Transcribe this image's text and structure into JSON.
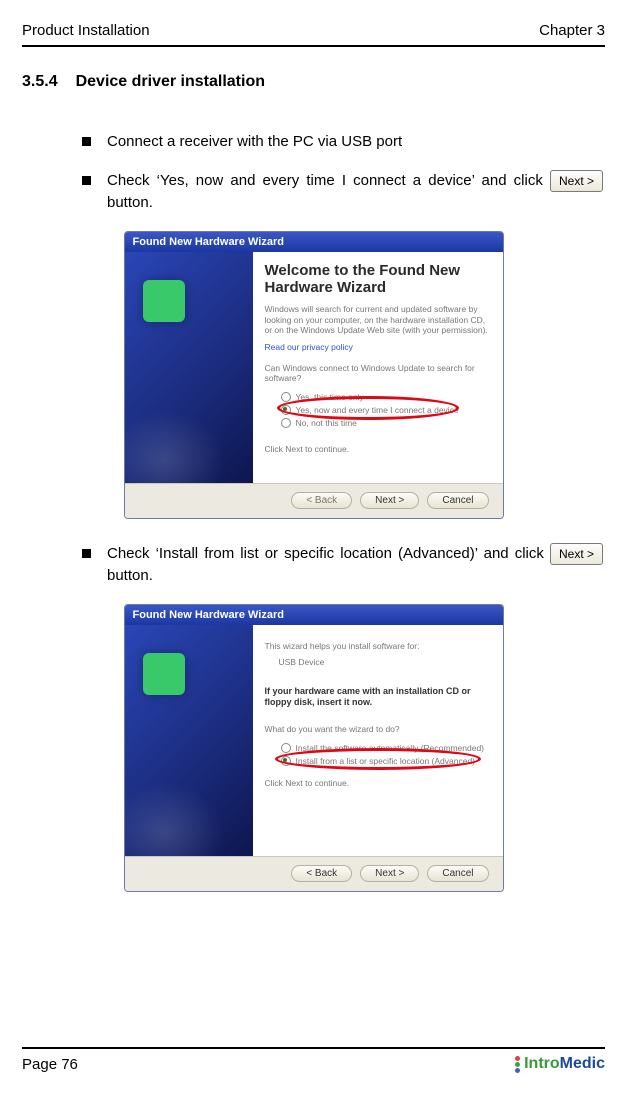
{
  "header": {
    "left": "Product Installation",
    "right": "Chapter 3"
  },
  "section": {
    "num": "3.5.4",
    "title": "Device driver installation"
  },
  "bullets": {
    "b1": "Connect a receiver with the PC via USB port",
    "b2_pre": "Check ‘Yes, now and every time I connect a device’ and click",
    "b2_btn": "Next >",
    "b2_post": " button.",
    "b3_pre": "Check ‘Install from list or specific location (Advanced)’ and click",
    "b3_btn": "Next >",
    "b3_post": " button."
  },
  "wizard1": {
    "titlebar": "Found New Hardware Wizard",
    "heading": "Welcome to the Found New Hardware Wizard",
    "para1": "Windows will search for current and updated software by looking on your computer, on the hardware installation CD, or on the Windows Update Web site (with your permission).",
    "link": "Read our privacy policy",
    "question": "Can Windows connect to Windows Update to search for software?",
    "opt1": "Yes, this time only",
    "opt2": "Yes, now and every time I connect a device",
    "opt3": "No, not this time",
    "proceed": "Click Next to continue.",
    "back": "< Back",
    "next": "Next >",
    "cancel": "Cancel"
  },
  "wizard2": {
    "titlebar": "Found New Hardware Wizard",
    "line1": "This wizard helps you install software for:",
    "device": "USB Device",
    "cd": "If your hardware came with an installation CD or floppy disk, insert it now.",
    "question": "What do you want the wizard to do?",
    "opt1": "Install the software automatically (Recommended)",
    "opt2": "Install from a list or specific location (Advanced)",
    "proceed": "Click Next to continue.",
    "back": "< Back",
    "next": "Next >",
    "cancel": "Cancel"
  },
  "footer": {
    "page": "Page 76",
    "brand1": "Intro",
    "brand2": "Medic"
  }
}
